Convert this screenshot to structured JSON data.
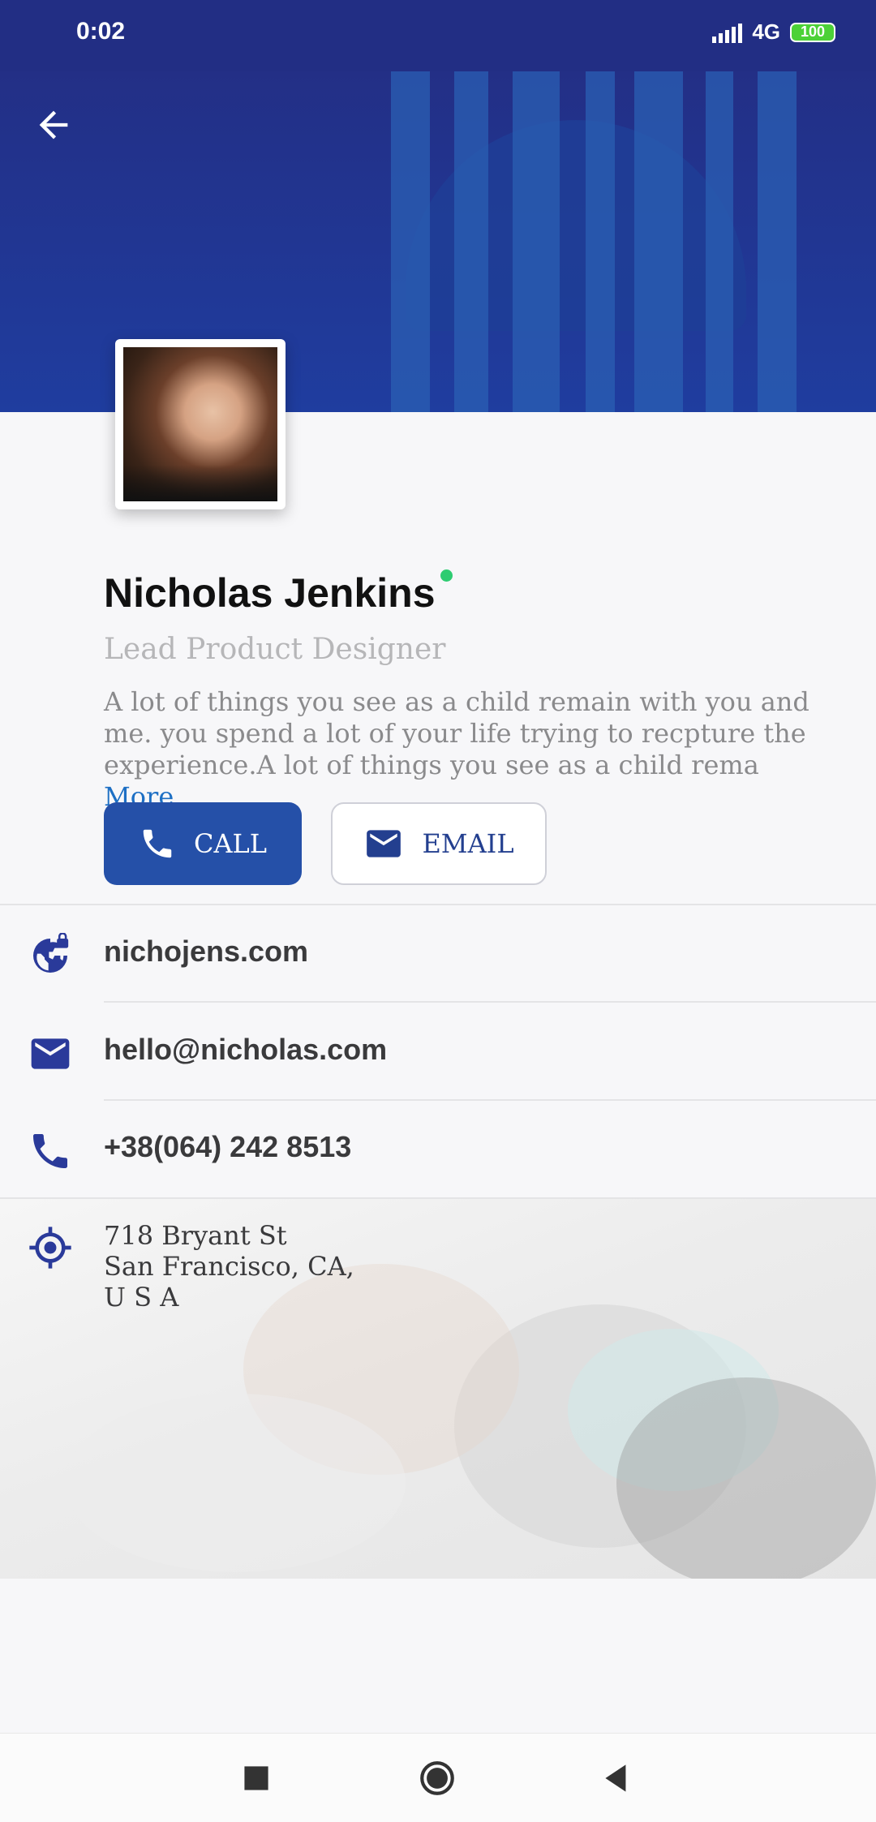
{
  "status_bar": {
    "time": "0:02",
    "network": "4G",
    "battery": "100"
  },
  "profile": {
    "name": "Nicholas Jenkins",
    "role": "Lead Product Designer",
    "bio": "A lot of things you see as a child remain with you and me. you spend a lot of your life trying to recpture the experience.A lot of things you see as a child rema",
    "more_label": "More"
  },
  "actions": {
    "call_label": "CALL",
    "email_label": "EMAIL"
  },
  "contact": {
    "website": "nichojens.com",
    "email": "hello@nicholas.com",
    "phone": "+38(064) 242 8513",
    "address": [
      "718 Bryant St",
      "San Francisco, CA,",
      "U S A"
    ]
  },
  "colors": {
    "primary": "#2550a8",
    "header": "#232f86",
    "online": "#2ecc71",
    "link": "#1d6fc4"
  }
}
